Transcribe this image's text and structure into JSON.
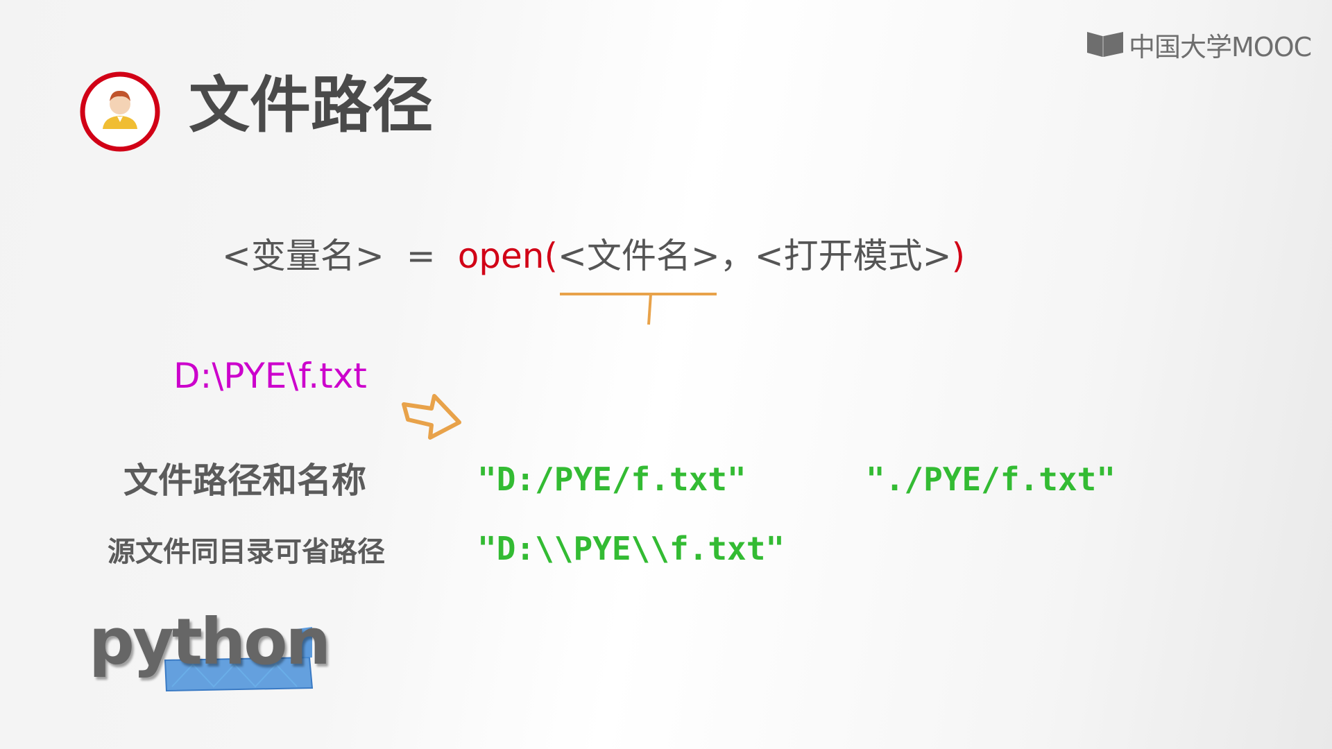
{
  "brand": {
    "name": "中国大学MOOC",
    "logo_color": "#6e6e6e"
  },
  "title": {
    "icon": "user-avatar-icon",
    "text": "文件路径",
    "accent_color": "#d10016"
  },
  "syntax": {
    "variable": "<变量名>",
    "equals": "=",
    "function": "open(",
    "args": "<文件名>，<打开模式>",
    "close": ")"
  },
  "example": {
    "path": "D:\\PYE\\f.txt",
    "arrow_icon": "right-arrow-icon"
  },
  "rows": [
    {
      "label": "文件路径和名称",
      "values": [
        "\"D:/PYE/f.txt\"",
        "\"./PYE/f.txt\""
      ]
    },
    {
      "label": "源文件同目录可省路径",
      "values": [
        "\"D:\\\\PYE\\\\f.txt\""
      ]
    }
  ],
  "footer_logo": {
    "text": "python"
  },
  "colors": {
    "heading": "#4a4a4a",
    "function_red": "#d10016",
    "path_magenta": "#cc00cc",
    "code_green": "#33bb33",
    "annotation_orange": "#e8a24a"
  }
}
